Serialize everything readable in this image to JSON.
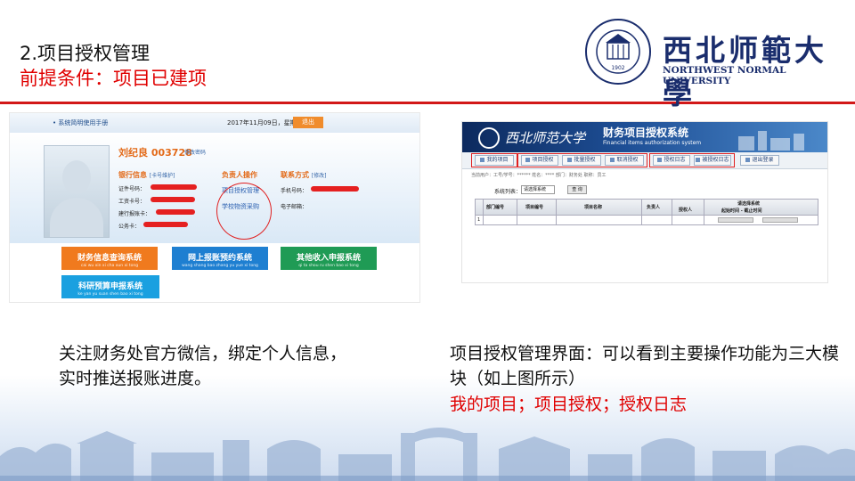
{
  "header": {
    "title": "2.项目授权管理",
    "precondition": "前提条件：项目已建项"
  },
  "logo": {
    "name_cn": "西北师範大學",
    "name_en": "NORTHWEST NORMAL UNIVERSITY",
    "seal_year": "1902"
  },
  "left_screenshot": {
    "manual_link": "• 系统简明使用手册",
    "date_text": "2017年11月09日，星期四",
    "logout_label": "退出",
    "user_name": "刘纪良 003728",
    "user_name_sub": "修改密码",
    "bank_info": {
      "heading": "银行信息",
      "action": "[卡号维护]"
    },
    "fields_left": [
      "证件号码：",
      "工资卡号：",
      "建行报账卡：",
      "公务卡："
    ],
    "responsible": {
      "heading": "负责人操作",
      "links": [
        "项目授权管理",
        "学校物资采购"
      ]
    },
    "contact": {
      "heading": "联系方式",
      "action": "[修改]",
      "fields": [
        "手机号码：",
        "电子邮箱："
      ]
    },
    "buttons": [
      {
        "label": "财务信息查询系统",
        "sub": "cai wu xin xi cha xun xi tong",
        "color": "#f07a1e"
      },
      {
        "label": "网上报账预约系统",
        "sub": "wang shang bao zhang yu yue xi tong",
        "color": "#1e7fd1"
      },
      {
        "label": "其他收入申报系统",
        "sub": "qi ta shou ru shen bao xi tong",
        "color": "#1f9b55"
      },
      {
        "label": "科研预算申报系统",
        "sub": "ke yan yu suan shen bao xi tong",
        "color": "#1aa0e0"
      }
    ]
  },
  "right_screenshot": {
    "school_name": "西北师范大学",
    "system_title": "财务项目授权系统",
    "system_title_en": "Financial items authorization system",
    "toolbar": [
      "我的项目",
      "项目授权",
      "批量授权",
      "取消授权",
      "授权日志",
      "被授权日志",
      "退出登录"
    ],
    "breadcrumb": "当前用户：工号/学号：******  姓名：****  部门：财务处 职称：员工",
    "filter_label": "系统列表：",
    "filter_value": "请选择系统",
    "query_label": "查 询",
    "table_headers": [
      "部门编号",
      "项目编号",
      "项目名称",
      "负责人",
      "授权人",
      "请选择系统",
      "起始时间 - 截止时间"
    ],
    "row_number": "1"
  },
  "captions": {
    "left": "关注财务处官方微信，绑定个人信息，实时推送报账进度。",
    "right": "项目授权管理界面：可以看到主要操作功能为三大模块（如上图所示）",
    "right_highlight": "我的项目；项目授权；授权日志"
  },
  "colors": {
    "accent_red": "#e00000",
    "brand_navy": "#1a2d6d"
  }
}
